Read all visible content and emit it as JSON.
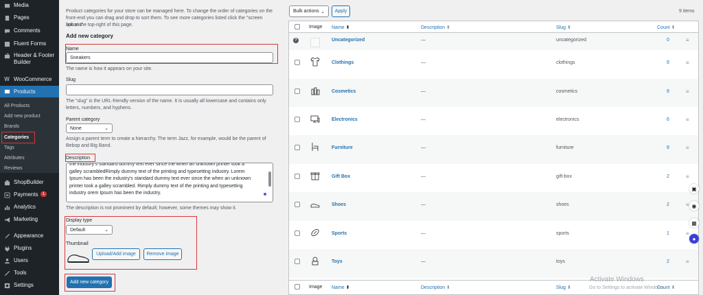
{
  "sidebar": {
    "items": [
      {
        "label": "Media",
        "icon": "media-icon"
      },
      {
        "label": "Pages",
        "icon": "pages-icon"
      },
      {
        "label": "Comments",
        "icon": "comments-icon"
      },
      {
        "label": "Fluent Forms",
        "icon": "fluent-forms-icon"
      },
      {
        "label": "Header & Footer Builder",
        "icon": "header-footer-icon"
      },
      {
        "label": "WooCommerce",
        "icon": "woocommerce-icon"
      },
      {
        "label": "Products",
        "icon": "products-icon"
      },
      {
        "label": "ShopBuilder",
        "icon": "shopbuilder-icon"
      },
      {
        "label": "Payments",
        "icon": "payments-icon",
        "badge": "1"
      },
      {
        "label": "Analytics",
        "icon": "analytics-icon"
      },
      {
        "label": "Marketing",
        "icon": "marketing-icon"
      },
      {
        "label": "Appearance",
        "icon": "appearance-icon"
      },
      {
        "label": "Plugins",
        "icon": "plugins-icon"
      },
      {
        "label": "Users",
        "icon": "users-icon"
      },
      {
        "label": "Tools",
        "icon": "tools-icon"
      },
      {
        "label": "Settings",
        "icon": "settings-icon"
      }
    ],
    "submenu": [
      "All Products",
      "Add new product",
      "Brands",
      "Categories",
      "Tags",
      "Attributes",
      "Reviews"
    ]
  },
  "form": {
    "intro": [
      "Product categories for your store can be managed here. To change the order of categories on the",
      "front-end you can drag and drop to sort them. To see more categories listed click the \"screen options\"",
      "link at the top-right of this page."
    ],
    "heading": "Add new category",
    "name_label": "Name",
    "name_value": "Sneakers",
    "name_help": "The name is how it appears on your site.",
    "slug_label": "Slug",
    "slug_value": "",
    "slug_help": [
      "The “slug” is the URL-friendly version of the name. It is usually all lowercase and contains only",
      "letters, numbers, and hyphens."
    ],
    "parent_label": "Parent category",
    "parent_value": "None",
    "parent_help": [
      "Assign a parent term to create a hierarchy. The term Jazz, for example, would be the parent of",
      "Bebop and Big Band."
    ],
    "description_label": "Description",
    "description_lines": [
      "the industry's standard dummy text ever since the when an unknown printer took a",
      "galley scrambledRimply dummy text of the printing and typesetting industry. Lorem",
      "Ipsum has been the industry's standard dummy text ever since the when an unknown",
      "printer took a galley scrambled. Rimply dummy text of the printing and typesetting",
      "industry orem Ipsum has been the industry."
    ],
    "description_help": "The description is not prominent by default; however, some themes may show it.",
    "display_type_label": "Display type",
    "display_type_value": "Default",
    "thumbnail_label": "Thumbnail",
    "upload_button": "Upload/Add image",
    "remove_button": "Remove image",
    "submit_button": "Add new category"
  },
  "table": {
    "bulk_actions": "Bulk actions",
    "apply": "Apply",
    "items_count": "9 items",
    "columns": {
      "image": "Image",
      "name": "Name",
      "description": "Description",
      "slug": "Slug",
      "count": "Count"
    },
    "sort_icon": "⬍",
    "rows": [
      {
        "name": "Uncategorized",
        "description": "—",
        "slug": "uncategorized",
        "count": "0",
        "icon": "placeholder-icon"
      },
      {
        "name": "Clothings",
        "description": "—",
        "slug": "clothings",
        "count": "9",
        "icon": "tshirt-icon"
      },
      {
        "name": "Cosmetics",
        "description": "—",
        "slug": "cosmetics",
        "count": "9",
        "icon": "cosmetics-icon"
      },
      {
        "name": "Electronics",
        "description": "—",
        "slug": "electronics",
        "count": "6",
        "icon": "monitor-icon"
      },
      {
        "name": "Furniture",
        "description": "—",
        "slug": "furniture",
        "count": "9",
        "icon": "chair-icon"
      },
      {
        "name": "Gift Box",
        "description": "—",
        "slug": "gift-box",
        "count": "2",
        "icon": "gift-icon"
      },
      {
        "name": "Shoes",
        "description": "—",
        "slug": "shoes",
        "count": "2",
        "icon": "shoe-icon"
      },
      {
        "name": "Sports",
        "description": "—",
        "slug": "sports",
        "count": "1",
        "icon": "football-icon"
      },
      {
        "name": "Toys",
        "description": "—",
        "slug": "toys",
        "count": "2",
        "icon": "toys-icon"
      }
    ]
  },
  "watermark": {
    "title": "Activate Windows",
    "subtitle": "Go to Settings to activate Windows."
  },
  "colors": {
    "accent": "#2271b1",
    "highlight": "#d63638",
    "sidebar": "#1d2327"
  }
}
